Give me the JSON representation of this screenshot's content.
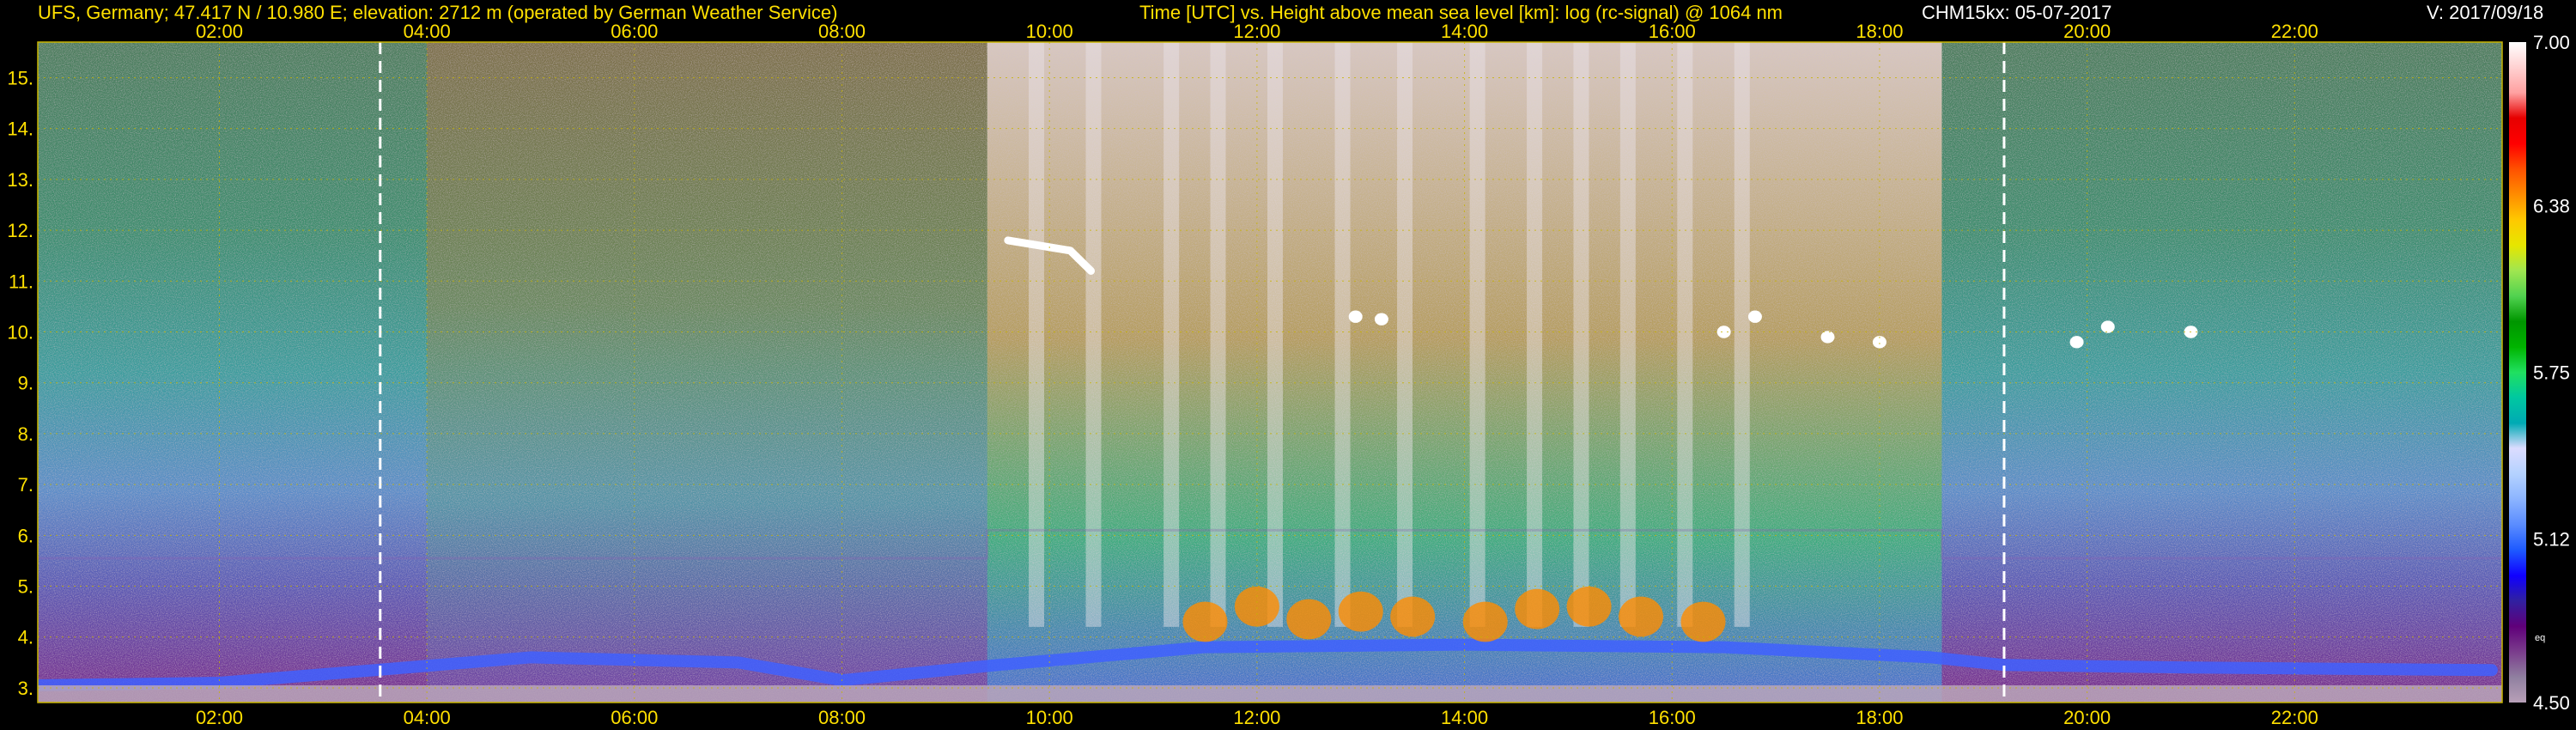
{
  "header": {
    "station": "UFS, Germany; 47.417 N / 10.980 E; elevation: 2712 m  (operated by German Weather Service)",
    "title": "Time [UTC] vs. Height above mean sea level [km]: log (rc-signal) @ 1064 nm",
    "instrument": "CHM15kx: 05-07-2017",
    "version": "V: 2017/09/18"
  },
  "colors": {
    "text_yellow": "#ffe000",
    "text_white": "#ffffff",
    "grid": "#c8b400",
    "marker": "#ffffff",
    "background_noise": "#c8b6c4"
  },
  "chart_data": {
    "type": "heatmap",
    "xlabel": "Time [UTC]",
    "ylabel": "Height above mean sea level [km]",
    "xlim": [
      0.25,
      24.0
    ],
    "ylim": [
      2.712,
      15.7
    ],
    "x_ticks": [
      2,
      4,
      6,
      8,
      10,
      12,
      14,
      16,
      18,
      20,
      22
    ],
    "x_tick_labels": [
      "02:00",
      "04:00",
      "06:00",
      "08:00",
      "10:00",
      "12:00",
      "14:00",
      "16:00",
      "18:00",
      "20:00",
      "22:00"
    ],
    "y_ticks": [
      3,
      4,
      5,
      6,
      7,
      8,
      9,
      10,
      11,
      12,
      13,
      14,
      15
    ],
    "y_tick_labels": [
      "3.",
      "4.",
      "5.",
      "6.",
      "7.",
      "8.",
      "9.",
      "10.",
      "11.",
      "12.",
      "13.",
      "14.",
      "15."
    ],
    "grid": true,
    "time_markers": [
      3.55,
      19.2
    ],
    "colorbar": {
      "min": 4.5,
      "max": 7.0,
      "tick_values": [
        7.0,
        6.38,
        5.75,
        5.12,
        4.5
      ],
      "tick_labels": [
        "7.00",
        "6.38",
        "5.75",
        "5.12",
        "4.50"
      ],
      "small_label": "eq",
      "colors": [
        "#b8a0b8",
        "#9080a0",
        "#7a3c8c",
        "#60007a",
        "#3020a0",
        "#1000ff",
        "#1e5aff",
        "#5a8cff",
        "#8cb4ff",
        "#b4d2ff",
        "#dcdcff",
        "#00aab4",
        "#00c8a0",
        "#20e060",
        "#00b400",
        "#009600",
        "#50d250",
        "#a0e650",
        "#e6e600",
        "#ffc800",
        "#ff8c00",
        "#ff5000",
        "#ff0000",
        "#e60000",
        "#ffa0a0",
        "#ffd2d2",
        "#ffffff"
      ]
    },
    "layers": [
      {
        "name": "sky_noise_level",
        "x": [
          0.25,
          9.4,
          9.4,
          18.6,
          18.6,
          24.0
        ],
        "y": [
          5.55,
          5.55,
          6.1,
          6.1,
          5.55,
          5.55
        ]
      },
      {
        "name": "boundary_layer_top",
        "x": [
          0.25,
          2.0,
          3.5,
          5.0,
          7.0,
          8.0,
          9.5,
          11.5,
          14.0,
          16.5,
          18.5,
          19.2,
          21.0,
          23.9
        ],
        "y": [
          3.05,
          3.1,
          3.35,
          3.6,
          3.5,
          3.15,
          3.45,
          3.8,
          3.85,
          3.8,
          3.6,
          3.45,
          3.4,
          3.35
        ]
      },
      {
        "name": "convective_plumes",
        "x": [
          11.5,
          12.0,
          12.5,
          13.0,
          13.5,
          14.2,
          14.7,
          15.2,
          15.7,
          16.3
        ],
        "y": [
          4.3,
          4.6,
          4.35,
          4.5,
          4.4,
          4.3,
          4.55,
          4.6,
          4.4,
          4.3
        ]
      },
      {
        "name": "cloud_12km",
        "x": [
          9.6,
          9.9,
          10.2,
          10.4
        ],
        "y": [
          11.8,
          11.7,
          11.6,
          11.2
        ]
      },
      {
        "name": "cloud_10km",
        "x": [
          12.95,
          13.2,
          16.5,
          16.8,
          17.5,
          18.0,
          19.9,
          20.2,
          21.0
        ],
        "y": [
          10.3,
          10.25,
          10.0,
          10.3,
          9.9,
          9.8,
          9.8,
          10.1,
          10.0
        ]
      }
    ]
  }
}
